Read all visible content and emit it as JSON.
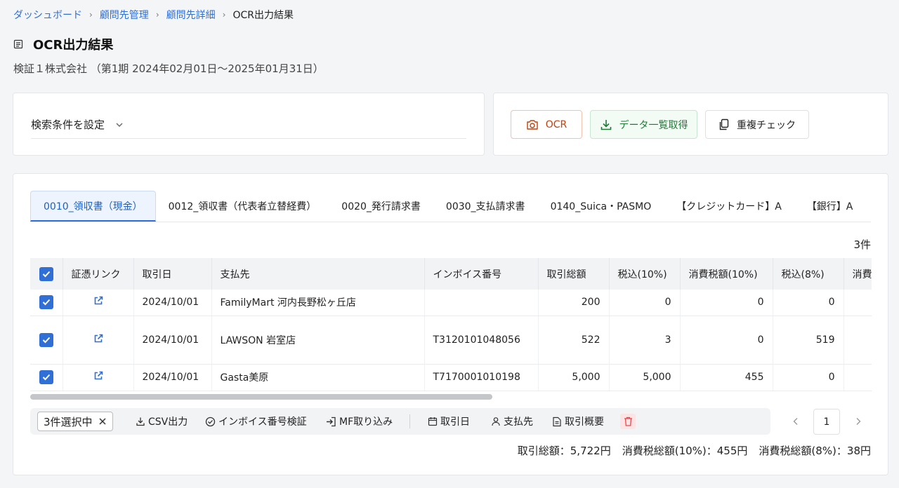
{
  "breadcrumb": {
    "items": [
      "ダッシュボード",
      "顧問先管理",
      "顧問先詳細"
    ],
    "current": "OCR出力結果"
  },
  "page": {
    "title": "OCR出力結果",
    "subtitle": "検証１株式会社 （第1期 2024年02月01日～2025年01月31日）"
  },
  "search": {
    "label": "検索条件を設定"
  },
  "actions": {
    "ocr": "OCR",
    "data_download": "データ一覧取得",
    "duplicate_check": "重複チェック"
  },
  "tabs": [
    "0010_領収書（現金）",
    "0012_領収書（代表者立替経費）",
    "0020_発行請求書",
    "0030_支払請求書",
    "0140_Suica・PASMO",
    "【クレジットカード】A",
    "【銀行】A"
  ],
  "result_count": "3件",
  "table": {
    "headers": [
      "証憑リンク",
      "取引日",
      "支払先",
      "インボイス番号",
      "取引総額",
      "税込(10%)",
      "消費税額(10%)",
      "税込(8%)",
      "消費"
    ],
    "rows": [
      {
        "date": "2024/10/01",
        "payee": "FamilyMart 河内長野松ヶ丘店",
        "invoice": "",
        "total": "200",
        "tax10": "0",
        "ctax10": "0",
        "tax8": "0"
      },
      {
        "date": "2024/10/01",
        "payee": "LAWSON 岩室店",
        "invoice": "T3120101048056",
        "total": "522",
        "tax10": "3",
        "ctax10": "0",
        "tax8": "519"
      },
      {
        "date": "2024/10/01",
        "payee": "Gasta美原",
        "invoice": "T7170001010198",
        "total": "5,000",
        "tax10": "5,000",
        "ctax10": "455",
        "tax8": "0"
      }
    ]
  },
  "bulk": {
    "selected": "3件選択中",
    "csv": "CSV出力",
    "invoice_verify": "インボイス番号検証",
    "mf_import": "MF取り込み",
    "date": "取引日",
    "payee": "支払先",
    "summary": "取引概要"
  },
  "pager": {
    "page": "1"
  },
  "totals": {
    "total": "取引総額：5,722円",
    "tax10": "消費税総額(10%)：455円",
    "tax8": "消費税総額(8%)：38円"
  },
  "colors": {
    "accent": "#2f6fd6",
    "ocr": "#c2410c",
    "download": "#1f7a36",
    "delete": "#e5484d"
  }
}
